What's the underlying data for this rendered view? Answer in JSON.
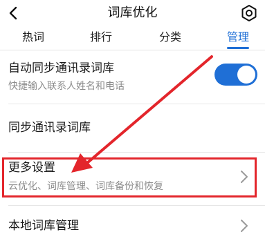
{
  "header": {
    "title": "词库优化",
    "back_icon": "chevron-left-icon",
    "settings_icon": "hexagon-settings-icon"
  },
  "tabs": [
    {
      "label": "热词",
      "active": false
    },
    {
      "label": "排行",
      "active": false
    },
    {
      "label": "分类",
      "active": false
    },
    {
      "label": "管理",
      "active": true
    }
  ],
  "rows": {
    "auto_sync": {
      "title": "自动同步通讯录词库",
      "subtitle": "快捷输入联系人姓名和电话",
      "toggle_on": true
    },
    "sync_contacts": {
      "title": "同步通讯录词库"
    },
    "more_settings": {
      "title": "更多设置",
      "subtitle": "云优化、词库管理、词库备份和恢复"
    },
    "local_lexicon": {
      "title": "本地词库管理"
    }
  },
  "colors": {
    "accent": "#1f6fd6",
    "annotation_red": "#e3252b",
    "subtitle_gray": "#8c8c8c"
  }
}
